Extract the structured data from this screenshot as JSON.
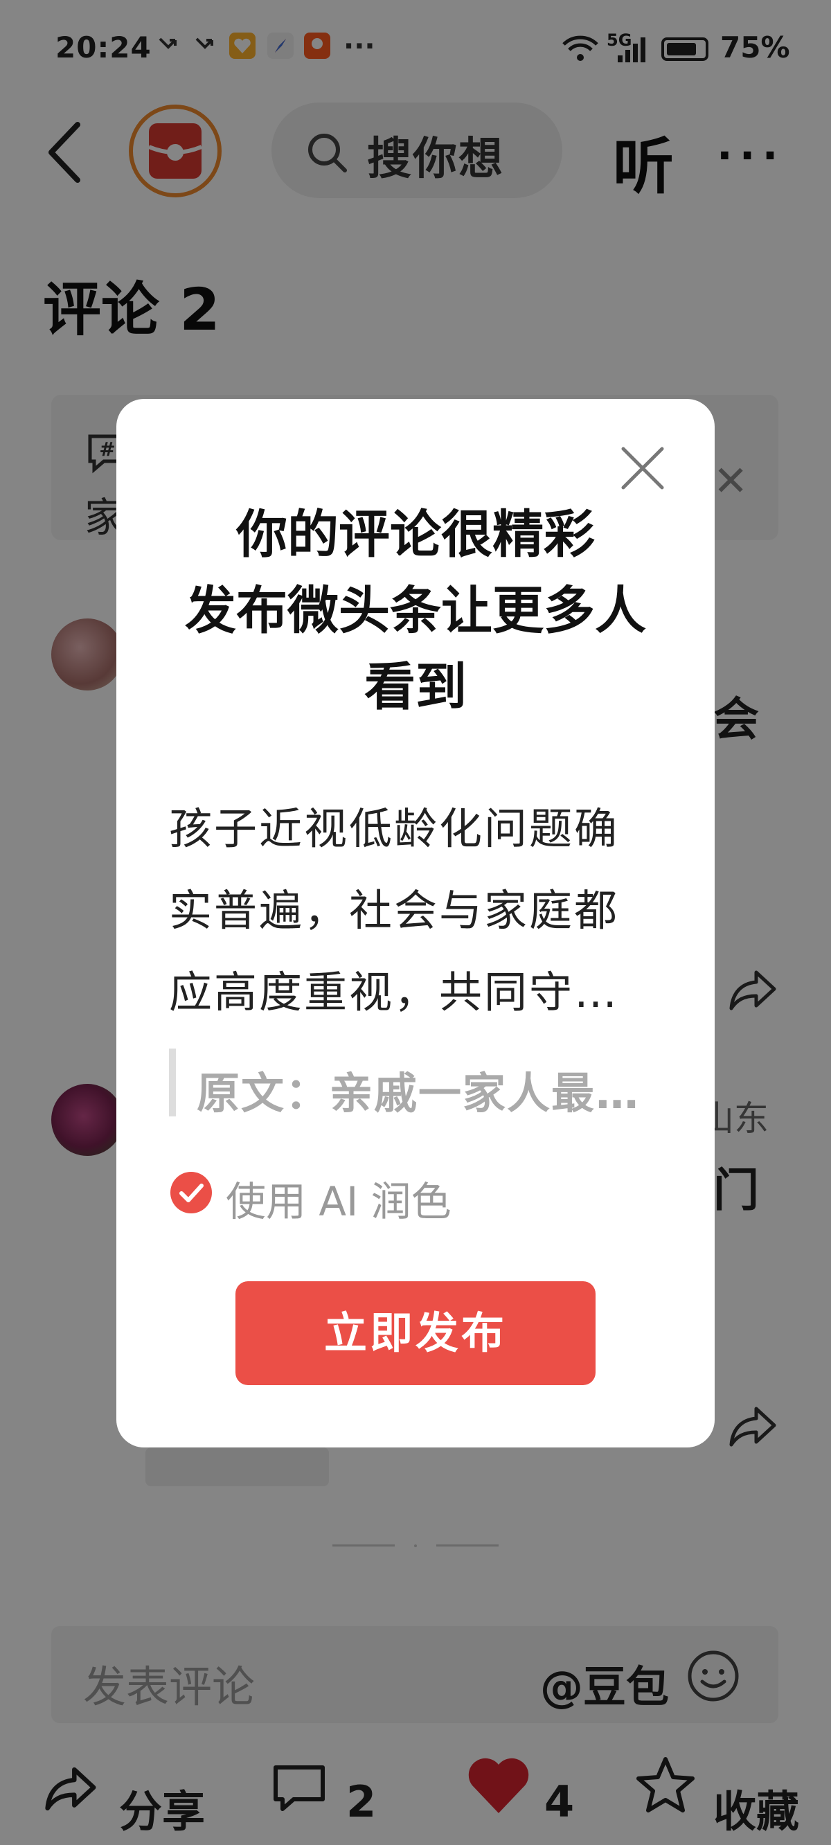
{
  "status_bar": {
    "time": "20:24",
    "battery": "75%",
    "network": "5G"
  },
  "header": {
    "search_placeholder": "搜你想",
    "listen_label": "听",
    "more_label": "···"
  },
  "comments": {
    "title": "评论 2",
    "topic_text": "家",
    "partial_1": "会",
    "partial_2": "山东",
    "partial_3": "门"
  },
  "comment_input": {
    "placeholder": "发表评论",
    "mention": "@豆包"
  },
  "bottom_bar": {
    "share_label": "分享",
    "comment_count": "2",
    "like_count": "4",
    "favorite_label": "收藏"
  },
  "dialog": {
    "title_lines": [
      "你的评论很精彩",
      "发布微头条让更多人",
      "看到"
    ],
    "body_lines": [
      "孩子近视低龄化问题确",
      "实普遍，社会与家庭都",
      "应高度重视，共同守…"
    ],
    "quote": "原文：亲戚一家人最…",
    "ai_polish_label": "使用 AI 润色",
    "ai_polish_checked": true,
    "publish_label": "立即发布"
  },
  "colors": {
    "accent": "#eb4f47",
    "like": "#d9232f"
  }
}
